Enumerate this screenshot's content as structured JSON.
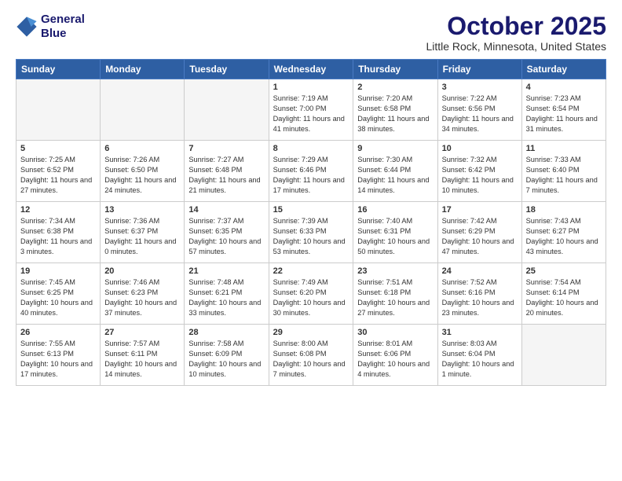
{
  "header": {
    "logo_line1": "General",
    "logo_line2": "Blue",
    "month": "October 2025",
    "location": "Little Rock, Minnesota, United States"
  },
  "weekdays": [
    "Sunday",
    "Monday",
    "Tuesday",
    "Wednesday",
    "Thursday",
    "Friday",
    "Saturday"
  ],
  "weeks": [
    [
      {
        "day": "",
        "info": ""
      },
      {
        "day": "",
        "info": ""
      },
      {
        "day": "",
        "info": ""
      },
      {
        "day": "1",
        "info": "Sunrise: 7:19 AM\nSunset: 7:00 PM\nDaylight: 11 hours and 41 minutes."
      },
      {
        "day": "2",
        "info": "Sunrise: 7:20 AM\nSunset: 6:58 PM\nDaylight: 11 hours and 38 minutes."
      },
      {
        "day": "3",
        "info": "Sunrise: 7:22 AM\nSunset: 6:56 PM\nDaylight: 11 hours and 34 minutes."
      },
      {
        "day": "4",
        "info": "Sunrise: 7:23 AM\nSunset: 6:54 PM\nDaylight: 11 hours and 31 minutes."
      }
    ],
    [
      {
        "day": "5",
        "info": "Sunrise: 7:25 AM\nSunset: 6:52 PM\nDaylight: 11 hours and 27 minutes."
      },
      {
        "day": "6",
        "info": "Sunrise: 7:26 AM\nSunset: 6:50 PM\nDaylight: 11 hours and 24 minutes."
      },
      {
        "day": "7",
        "info": "Sunrise: 7:27 AM\nSunset: 6:48 PM\nDaylight: 11 hours and 21 minutes."
      },
      {
        "day": "8",
        "info": "Sunrise: 7:29 AM\nSunset: 6:46 PM\nDaylight: 11 hours and 17 minutes."
      },
      {
        "day": "9",
        "info": "Sunrise: 7:30 AM\nSunset: 6:44 PM\nDaylight: 11 hours and 14 minutes."
      },
      {
        "day": "10",
        "info": "Sunrise: 7:32 AM\nSunset: 6:42 PM\nDaylight: 11 hours and 10 minutes."
      },
      {
        "day": "11",
        "info": "Sunrise: 7:33 AM\nSunset: 6:40 PM\nDaylight: 11 hours and 7 minutes."
      }
    ],
    [
      {
        "day": "12",
        "info": "Sunrise: 7:34 AM\nSunset: 6:38 PM\nDaylight: 11 hours and 3 minutes."
      },
      {
        "day": "13",
        "info": "Sunrise: 7:36 AM\nSunset: 6:37 PM\nDaylight: 11 hours and 0 minutes."
      },
      {
        "day": "14",
        "info": "Sunrise: 7:37 AM\nSunset: 6:35 PM\nDaylight: 10 hours and 57 minutes."
      },
      {
        "day": "15",
        "info": "Sunrise: 7:39 AM\nSunset: 6:33 PM\nDaylight: 10 hours and 53 minutes."
      },
      {
        "day": "16",
        "info": "Sunrise: 7:40 AM\nSunset: 6:31 PM\nDaylight: 10 hours and 50 minutes."
      },
      {
        "day": "17",
        "info": "Sunrise: 7:42 AM\nSunset: 6:29 PM\nDaylight: 10 hours and 47 minutes."
      },
      {
        "day": "18",
        "info": "Sunrise: 7:43 AM\nSunset: 6:27 PM\nDaylight: 10 hours and 43 minutes."
      }
    ],
    [
      {
        "day": "19",
        "info": "Sunrise: 7:45 AM\nSunset: 6:25 PM\nDaylight: 10 hours and 40 minutes."
      },
      {
        "day": "20",
        "info": "Sunrise: 7:46 AM\nSunset: 6:23 PM\nDaylight: 10 hours and 37 minutes."
      },
      {
        "day": "21",
        "info": "Sunrise: 7:48 AM\nSunset: 6:21 PM\nDaylight: 10 hours and 33 minutes."
      },
      {
        "day": "22",
        "info": "Sunrise: 7:49 AM\nSunset: 6:20 PM\nDaylight: 10 hours and 30 minutes."
      },
      {
        "day": "23",
        "info": "Sunrise: 7:51 AM\nSunset: 6:18 PM\nDaylight: 10 hours and 27 minutes."
      },
      {
        "day": "24",
        "info": "Sunrise: 7:52 AM\nSunset: 6:16 PM\nDaylight: 10 hours and 23 minutes."
      },
      {
        "day": "25",
        "info": "Sunrise: 7:54 AM\nSunset: 6:14 PM\nDaylight: 10 hours and 20 minutes."
      }
    ],
    [
      {
        "day": "26",
        "info": "Sunrise: 7:55 AM\nSunset: 6:13 PM\nDaylight: 10 hours and 17 minutes."
      },
      {
        "day": "27",
        "info": "Sunrise: 7:57 AM\nSunset: 6:11 PM\nDaylight: 10 hours and 14 minutes."
      },
      {
        "day": "28",
        "info": "Sunrise: 7:58 AM\nSunset: 6:09 PM\nDaylight: 10 hours and 10 minutes."
      },
      {
        "day": "29",
        "info": "Sunrise: 8:00 AM\nSunset: 6:08 PM\nDaylight: 10 hours and 7 minutes."
      },
      {
        "day": "30",
        "info": "Sunrise: 8:01 AM\nSunset: 6:06 PM\nDaylight: 10 hours and 4 minutes."
      },
      {
        "day": "31",
        "info": "Sunrise: 8:03 AM\nSunset: 6:04 PM\nDaylight: 10 hours and 1 minute."
      },
      {
        "day": "",
        "info": ""
      }
    ]
  ]
}
